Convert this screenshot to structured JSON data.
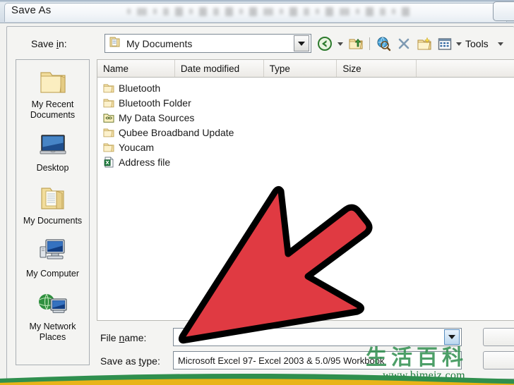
{
  "window": {
    "title": "Save As"
  },
  "toolbar_top": {
    "savein_label": "Save in:",
    "savein_value": "My Documents",
    "savein_icon": "folder-icon",
    "buttons": [
      {
        "name": "back-button",
        "icon": "back-arrow-icon",
        "label": ""
      },
      {
        "name": "back-dropdown",
        "icon": "chevron-down-icon",
        "label": ""
      },
      {
        "name": "up-one-level-button",
        "icon": "up-folder-icon",
        "label": ""
      },
      {
        "name": "search-web-button",
        "icon": "globe-search-icon",
        "label": ""
      },
      {
        "name": "delete-button",
        "icon": "x-delete-icon",
        "label": ""
      },
      {
        "name": "new-folder-button",
        "icon": "new-folder-icon",
        "label": ""
      },
      {
        "name": "views-button",
        "icon": "views-grid-icon",
        "label": ""
      }
    ],
    "tools_label": "Tools"
  },
  "places": {
    "items": [
      {
        "label": "My Recent Documents",
        "icon": "recent-documents-folder-icon"
      },
      {
        "label": "Desktop",
        "icon": "desktop-monitor-icon"
      },
      {
        "label": "My Documents",
        "icon": "my-documents-folder-icon"
      },
      {
        "label": "My Computer",
        "icon": "my-computer-icon"
      },
      {
        "label": "My Network Places",
        "icon": "network-places-icon"
      }
    ]
  },
  "file_list": {
    "columns": [
      "Name",
      "Date modified",
      "Type",
      "Size",
      ""
    ],
    "rows": [
      {
        "name": "Bluetooth",
        "icon": "folder-icon",
        "date_modified": "",
        "type": "",
        "size": ""
      },
      {
        "name": "Bluetooth Folder",
        "icon": "folder-icon",
        "date_modified": "",
        "type": "",
        "size": ""
      },
      {
        "name": "My Data Sources",
        "icon": "data-sources-folder-icon",
        "date_modified": "",
        "type": "",
        "size": ""
      },
      {
        "name": "Qubee Broadband Update",
        "icon": "folder-icon",
        "date_modified": "",
        "type": "",
        "size": ""
      },
      {
        "name": "Youcam",
        "icon": "folder-icon",
        "date_modified": "",
        "type": "",
        "size": ""
      },
      {
        "name": "Address file",
        "icon": "excel-file-icon",
        "date_modified": "",
        "type": "",
        "size": ""
      }
    ]
  },
  "bottom": {
    "filename_label": "File name:",
    "filename_value": "",
    "filename_placeholder": "",
    "filetype_label": "Save as type:",
    "filetype_value": "Microsoft Excel 97- Excel 2003 & 5.0/95 Workbook"
  },
  "annotation": {
    "name": "red-pointer-arrow",
    "color": "#E03A42",
    "outline": "#000000",
    "points_at": "File name field"
  },
  "watermark": {
    "chars": [
      "生",
      "活",
      "百",
      "科"
    ],
    "url": "www.bimeiz.com",
    "color": "#2f8f4e"
  }
}
